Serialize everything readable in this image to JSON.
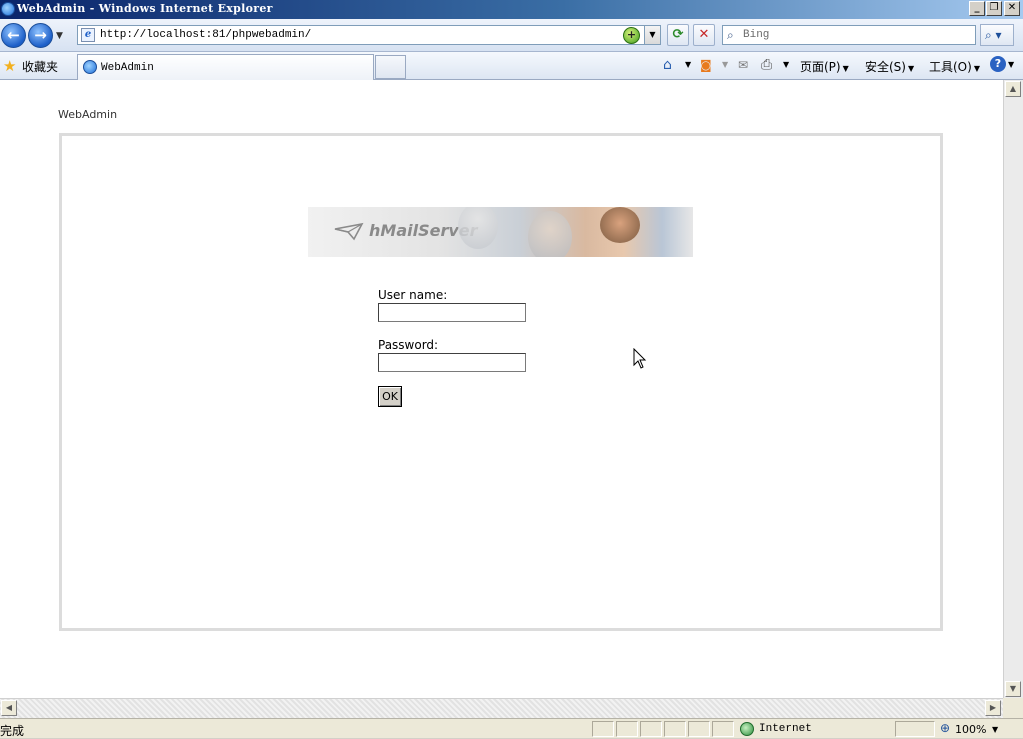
{
  "window": {
    "title": "WebAdmin - Windows Internet Explorer",
    "minimize_glyph": "_",
    "restore_glyph": "❐",
    "close_glyph": "✕"
  },
  "navigation": {
    "back_glyph": "←",
    "forward_glyph": "→",
    "url": "http://localhost:81/phpwebadmin/",
    "search_placeholder": "Bing",
    "refresh_glyph": "⟳",
    "stop_glyph": "✕",
    "search_go_glyph": "⌕ ▾"
  },
  "favorites_bar": {
    "favorites_label": "收藏夹",
    "tab_title": "WebAdmin"
  },
  "command_bar": {
    "home_icon": "home-icon",
    "feeds_icon": "feeds-icon",
    "mail_icon": "mail-icon",
    "print_icon": "print-icon",
    "page_label": "页面(P)",
    "safety_label": "安全(S)",
    "tools_label": "工具(O)",
    "help_glyph": "?"
  },
  "page": {
    "brand": "WebAdmin",
    "banner_logo_text": "hMailServer",
    "login": {
      "username_label": "User name:",
      "username_value": "",
      "password_label": "Password:",
      "password_value": "",
      "ok_label": "OK"
    }
  },
  "statusbar": {
    "status_text": "完成",
    "zone_label": "Internet",
    "zoom_label": "100%"
  },
  "colors": {
    "titlebar_start": "#0a246a",
    "titlebar_end": "#a6caf0",
    "panel_border": "#dcdcdc",
    "page_background": "#ffffff"
  }
}
